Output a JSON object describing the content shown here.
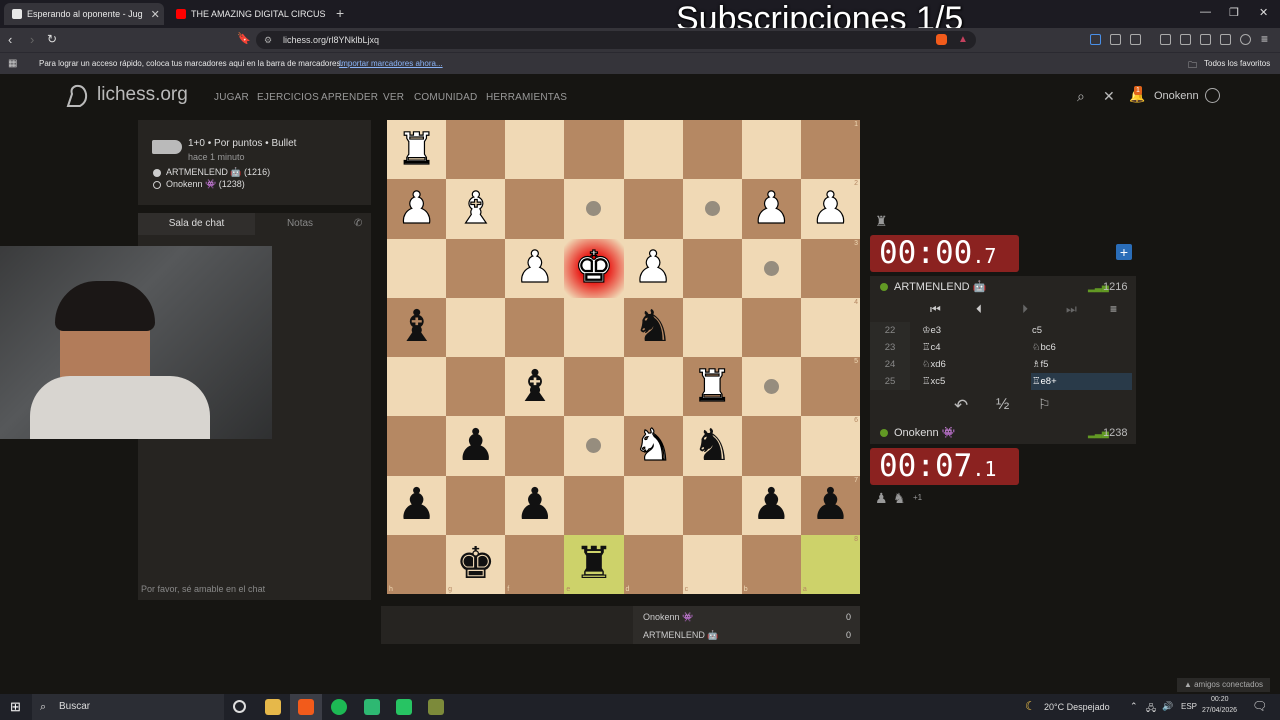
{
  "browser": {
    "tabs": [
      {
        "label": "Esperando al oponente - Jug",
        "active": true,
        "favicon_color": "#e8e8e8"
      },
      {
        "label": "THE AMAZING DIGITAL CIRCUS - Ep",
        "active": false,
        "favicon_color": "#ff0000"
      }
    ],
    "url": "lichess.org/rl8YNklbLjxq",
    "bookmarks_hint": "Para lograr un acceso rápido, coloca tus marcadores aquí en la barra de marcadores.",
    "bookmarks_import": "Importar marcadores ahora...",
    "bookmarks_all": "Todos los favoritos"
  },
  "overlay": {
    "title": "Subscripciones 1/5"
  },
  "site": {
    "logo": "lichess.org",
    "nav": [
      "JUGAR",
      "EJERCICIOS",
      "APRENDER",
      "VER",
      "COMUNIDAD",
      "HERRAMIENTAS"
    ],
    "user": "Onokenn",
    "notif_count": "1"
  },
  "game_info": {
    "mode": "1+0 • Por puntos • Bullet",
    "when": "hace 1 minuto",
    "white_player": "ARTMENLEND 🤖 (1216)",
    "black_player": "Onokenn 👾 (1238)"
  },
  "chat": {
    "tab_chat": "Sala de chat",
    "tab_notes": "Notas",
    "placeholder": "Por favor, sé amable en el chat"
  },
  "board": {
    "orientation": "black",
    "ranks": [
      "1",
      "2",
      "3",
      "4",
      "5",
      "6",
      "7",
      "8"
    ],
    "files": [
      "h",
      "g",
      "f",
      "e",
      "d",
      "c",
      "b",
      "a"
    ],
    "pieces": [
      [
        "wR",
        "",
        "",
        "",
        "",
        "",
        "",
        ""
      ],
      [
        "wP",
        "wB",
        "",
        "dot",
        "",
        "dot",
        "wP",
        "wP"
      ],
      [
        "",
        "",
        "wP",
        "wK",
        "wP",
        "",
        "dot",
        ""
      ],
      [
        "bB",
        "",
        "",
        "",
        "bN",
        "",
        "",
        ""
      ],
      [
        "",
        "",
        "bB",
        "",
        "",
        "wR",
        "dot",
        ""
      ],
      [
        "",
        "bP",
        "",
        "dot",
        "wN",
        "bN",
        "",
        ""
      ],
      [
        "bP",
        "",
        "bP",
        "",
        "",
        "",
        "bP",
        "bP"
      ],
      [
        "",
        "bK",
        "",
        "bR",
        "",
        "",
        "",
        ""
      ]
    ],
    "check_square": "e3",
    "last_move": [
      "e8",
      "a8"
    ]
  },
  "opponent": {
    "name": "ARTMENLEND 🤖",
    "rating": "1216",
    "clock_main": "00:00",
    "clock_tenths": ".7"
  },
  "player": {
    "name": "Onokenn 👾",
    "rating": "1238",
    "clock_main": "00:07",
    "clock_tenths": ".1",
    "material": "+1"
  },
  "moves": [
    {
      "n": "22",
      "w": "♔e3",
      "b": "c5"
    },
    {
      "n": "23",
      "w": "♖c4",
      "b": "♘bc6"
    },
    {
      "n": "24",
      "w": "♘xd6",
      "b": "♗f5"
    },
    {
      "n": "25",
      "w": "♖xc5",
      "b": "♖e8+"
    }
  ],
  "actions": {
    "draw": "½"
  },
  "scores": [
    {
      "name": "Onokenn 👾",
      "score": "0"
    },
    {
      "name": "ARTMENLEND 🤖",
      "score": "0"
    }
  ],
  "friends": "amigos conectados",
  "taskbar": {
    "search": "Buscar",
    "weather": "20°C  Despejado",
    "lang": "ESP",
    "time": "00:20",
    "date": "27/04/2026"
  }
}
